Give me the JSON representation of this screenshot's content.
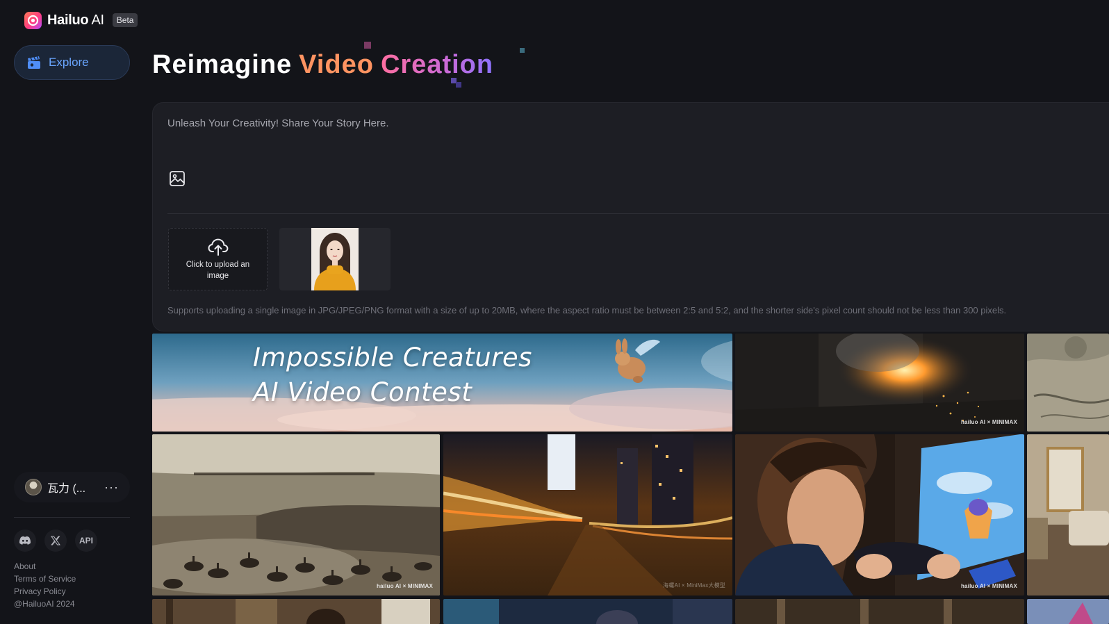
{
  "brand": {
    "name_bold": "Hailuo",
    "name_thin": " AI",
    "badge": "Beta"
  },
  "nav": {
    "explore": "Explore"
  },
  "hero": {
    "word1": "Reimagine",
    "word2": "Video",
    "word3": "Creation"
  },
  "prompt": {
    "placeholder": "Unleash Your Creativity! Share Your Story Here.",
    "upload_label": "Click to upload an image",
    "support_note": "Supports uploading a single image in JPG/JPEG/PNG format with a size of up to 20MB, where the aspect ratio must be between 2:5 and 5:2, and the shorter side's pixel count should not be less than 300 pixels."
  },
  "gallery": {
    "banner_line1": "Impossible Creatures",
    "banner_line2": "AI Video Contest",
    "watermark": "hailuo AI × MINIMAX",
    "watermark_cn": "海螺AI × MiniMax大模型"
  },
  "user": {
    "name": "瓦力 (...",
    "more": "···"
  },
  "socials": {
    "api": "API"
  },
  "footer": {
    "about": "About",
    "terms": "Terms of Service",
    "privacy": "Privacy Policy",
    "copyright": "@HailuoAI 2024"
  },
  "icons": {
    "logo": "hailuo-logo-icon",
    "explore": "clapperboard-icon",
    "image_tool": "image-icon",
    "upload": "cloud-upload-icon",
    "discord": "discord-icon",
    "x": "x-icon"
  },
  "colors": {
    "background": "#131419",
    "panel": "#1d1e24",
    "accent_blue": "#6aa6ff",
    "hero_orange": "#ff9361",
    "hero_pink": "#ff6fa1",
    "hero_purple": "#8c73ff"
  }
}
